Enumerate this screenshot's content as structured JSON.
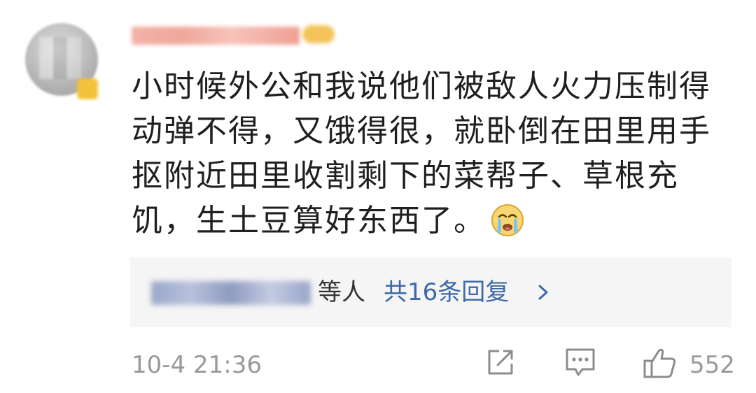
{
  "comment": {
    "text": "小时候外公和我说他们被敌人火力压制得动弹不得，又饿得很，就卧倒在田里用手抠附近田里收割剩下的菜帮子、草根充饥，生土豆算好东西了。",
    "emoji_name": "crying-emoji"
  },
  "replies": {
    "suffix": "等人",
    "count_label": "共16条回复"
  },
  "footer": {
    "timestamp": "10-4 21:36",
    "like_count": "552"
  },
  "icons": {
    "share": "share-icon",
    "comment": "comment-icon",
    "like": "thumbs-up-icon",
    "chevron": "chevron-right-icon"
  },
  "colors": {
    "link_blue": "#3d6aa6",
    "meta_gray": "#999999",
    "reply_bg": "#f5f5f5"
  }
}
